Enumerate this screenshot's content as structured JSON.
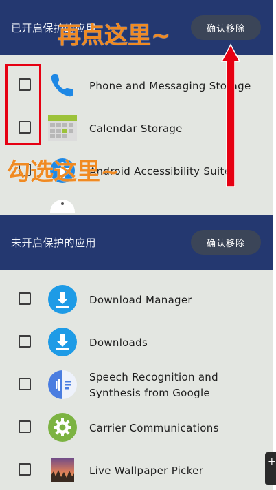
{
  "protected": {
    "title": "已开启保护的应用",
    "confirm_label": "确认移除",
    "items": [
      {
        "label": "Phone and Messaging Storage",
        "icon": "phone-icon"
      },
      {
        "label": "Calendar Storage",
        "icon": "calendar-icon"
      },
      {
        "label": "Android Accessibility Suite",
        "icon": "accessibility-icon"
      }
    ]
  },
  "unprotected": {
    "title": "未开启保护的应用",
    "confirm_label": "确认移除",
    "items": [
      {
        "label": "Download Manager",
        "icon": "download-icon"
      },
      {
        "label": "Downloads",
        "icon": "download-icon"
      },
      {
        "label": "Speech Recognition and Synthesis from Google",
        "icon": "speech-icon"
      },
      {
        "label": "Carrier Communications",
        "icon": "gear-icon"
      },
      {
        "label": "Live Wallpaper Picker",
        "icon": "wallpaper-icon"
      }
    ]
  },
  "annotations": {
    "tap_here_again": "再点这里~",
    "check_here": "勾选这里~"
  },
  "side_tab_glyph": "+",
  "colors": {
    "header_bg": "#243870",
    "pill_bg": "#3b4558",
    "list_bg": "#e3e6e1",
    "annotation_red": "#e60012",
    "annotation_orange": "#f08a22"
  }
}
